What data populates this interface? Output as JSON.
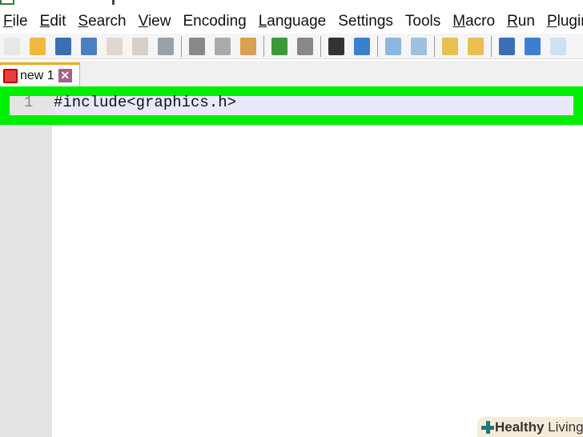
{
  "menu": [
    {
      "label": "File",
      "key": "F",
      "rest": "ile"
    },
    {
      "label": "Edit",
      "key": "E",
      "rest": "dit"
    },
    {
      "label": "Search",
      "key": "S",
      "rest": "earch"
    },
    {
      "label": "View",
      "key": "V",
      "rest": "iew"
    },
    {
      "label": "Encoding",
      "pre": "E",
      "key": "n",
      "rest": "coding"
    },
    {
      "label": "Language",
      "key": "L",
      "rest": "anguage"
    },
    {
      "label": "Settings",
      "pre": "Se",
      "key": "t",
      "rest": "tings"
    },
    {
      "label": "Tools",
      "pre": "T",
      "key": "o",
      "rest": "ols"
    },
    {
      "label": "Macro",
      "key": "M",
      "rest": "acro"
    },
    {
      "label": "Run",
      "key": "R",
      "rest": "un"
    },
    {
      "label": "Plugins",
      "key": "P",
      "rest": "lugins"
    }
  ],
  "toolbar": [
    {
      "icon": "new-file-icon",
      "color": "#e8e8e8"
    },
    {
      "icon": "open-folder-icon",
      "color": "#f0b840"
    },
    {
      "icon": "save-icon",
      "color": "#3a6fb8"
    },
    {
      "icon": "save-all-icon",
      "color": "#4a80c0"
    },
    {
      "icon": "close-file-icon",
      "color": "#e0d8d0"
    },
    {
      "icon": "close-all-icon",
      "color": "#d8d0c8"
    },
    {
      "icon": "print-icon",
      "color": "#9aa0a8"
    },
    {
      "sep": true
    },
    {
      "icon": "cut-icon",
      "color": "#888"
    },
    {
      "icon": "copy-icon",
      "color": "#aaa"
    },
    {
      "icon": "paste-icon",
      "color": "#d8a050"
    },
    {
      "sep": true
    },
    {
      "icon": "undo-icon",
      "color": "#3a9a3a"
    },
    {
      "icon": "redo-icon",
      "color": "#888"
    },
    {
      "sep": true
    },
    {
      "icon": "find-icon",
      "color": "#333"
    },
    {
      "icon": "replace-icon",
      "color": "#3a80d0"
    },
    {
      "sep": true
    },
    {
      "icon": "zoom-in-icon",
      "color": "#8ab8e0"
    },
    {
      "icon": "zoom-out-icon",
      "color": "#a0c0e0"
    },
    {
      "sep": true
    },
    {
      "icon": "sync-vertical-icon",
      "color": "#e8c050"
    },
    {
      "icon": "sync-horizontal-icon",
      "color": "#e8c050"
    },
    {
      "sep": true
    },
    {
      "icon": "word-wrap-icon",
      "color": "#3a6fb8"
    },
    {
      "icon": "show-all-characters-icon",
      "color": "#3a80d0"
    },
    {
      "icon": "indent-guide-icon",
      "color": "#cfe0f5"
    }
  ],
  "tab": {
    "label": "new 1",
    "close": "✕"
  },
  "editor": {
    "lines": [
      {
        "number": "1",
        "text": "#include<graphics.h>"
      }
    ]
  },
  "watermark": {
    "bold": "Healthy",
    "rest": " Living"
  },
  "colors": {
    "highlight_box": "#00ee00",
    "current_line": "#e8e8fa",
    "tab_accent": "#f5a623"
  }
}
